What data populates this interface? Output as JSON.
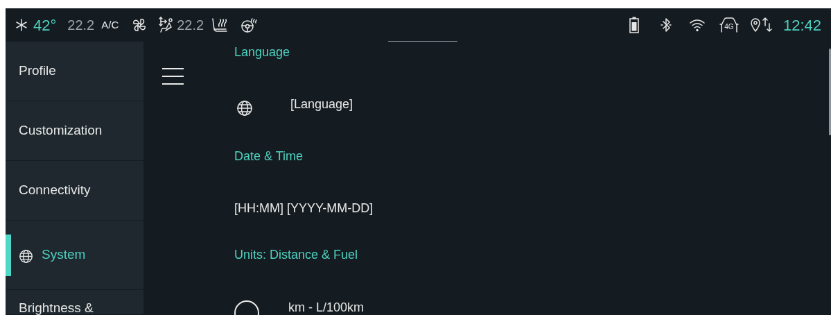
{
  "status_bar": {
    "outside_temp": "42°",
    "driver_temp": "22.2",
    "ac_label": "A/C",
    "passenger_temp": "22.2",
    "network_label": "4G",
    "time": "12:42"
  },
  "sidebar": {
    "items": [
      {
        "label": "Profile",
        "selected": false
      },
      {
        "label": "Customization",
        "selected": false
      },
      {
        "label": "Connectivity",
        "selected": false
      },
      {
        "label": "System",
        "selected": true
      },
      {
        "label": "Brightness &",
        "selected": false
      }
    ]
  },
  "content": {
    "rows": [
      {
        "kind": "header",
        "text": "Language"
      },
      {
        "kind": "option",
        "text": "[Language]"
      },
      {
        "kind": "header",
        "text": "Date & Time"
      },
      {
        "kind": "value",
        "text": "[HH:MM] [YYYY-MM-DD]"
      },
      {
        "kind": "header",
        "text": "Units: Distance & Fuel"
      },
      {
        "kind": "radio",
        "text": "km - L/100km",
        "selected": false
      }
    ]
  }
}
